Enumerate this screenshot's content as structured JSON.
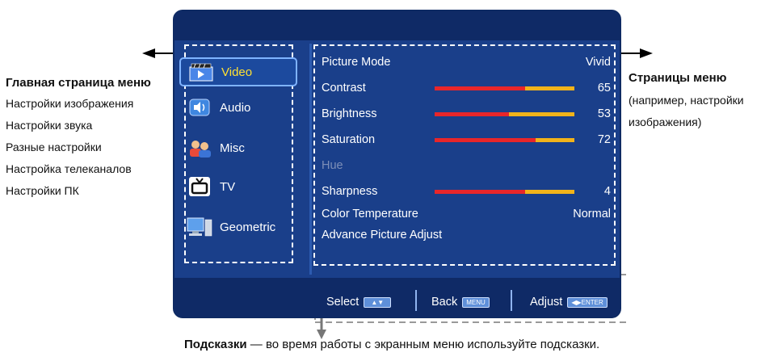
{
  "left_annotation": {
    "title": "Главная страница меню",
    "lines": [
      "Настройки изображения",
      "Настройки звука",
      "Разные настройки",
      "Настройка телеканалов",
      "Настройки ПК"
    ]
  },
  "right_annotation": {
    "title": "Страницы меню",
    "line1": "(например, настройки",
    "line2": "изображения)"
  },
  "bottom_annotation": {
    "bold": "Подсказки",
    "rest": " — во время работы с экранным меню используйте подсказки."
  },
  "menu": {
    "items": [
      {
        "label": "Video",
        "icon": "film-icon",
        "active": true
      },
      {
        "label": "Audio",
        "icon": "speaker-icon",
        "active": false
      },
      {
        "label": "Misc",
        "icon": "people-icon",
        "active": false
      },
      {
        "label": "TV",
        "icon": "tv-icon",
        "active": false
      },
      {
        "label": "Geometric",
        "icon": "monitor-icon",
        "active": false
      }
    ]
  },
  "settings": [
    {
      "label": "Picture Mode",
      "value": "Vivid"
    },
    {
      "label": "Contrast",
      "value": "65",
      "level": 0.65
    },
    {
      "label": "Brightness",
      "value": "53",
      "level": 0.53
    },
    {
      "label": "Saturation",
      "value": "72",
      "level": 0.72
    },
    {
      "label": "Hue",
      "value": "",
      "disabled": true
    },
    {
      "label": "Sharpness",
      "value": "4",
      "level": 0.65
    },
    {
      "label": "Color Temperature",
      "value": "Normal"
    },
    {
      "label": "Advance Picture Adjust",
      "value": ""
    }
  ],
  "hints": {
    "select": "Select",
    "back": "Back",
    "back_key": "MENU",
    "adjust": "Adjust",
    "adjust_key": "ENTER"
  },
  "colors": {
    "screen": "#1a3f8a",
    "bar_red": "#e8262a",
    "bar_yellow": "#f2b31a",
    "active_text": "#ffe033"
  }
}
